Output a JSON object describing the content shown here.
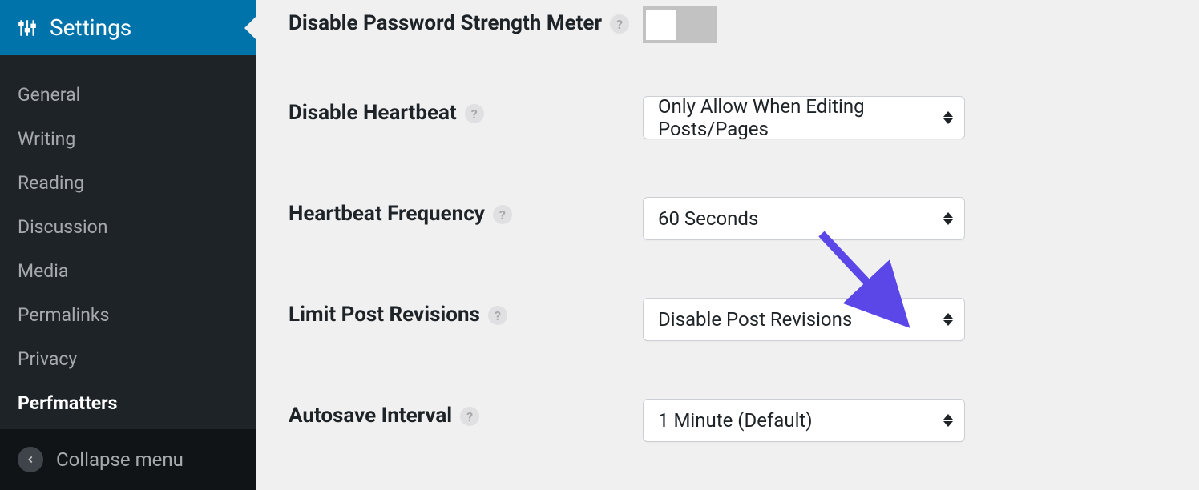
{
  "sidebar": {
    "header": {
      "label": "Settings"
    },
    "items": [
      {
        "label": "General"
      },
      {
        "label": "Writing"
      },
      {
        "label": "Reading"
      },
      {
        "label": "Discussion"
      },
      {
        "label": "Media"
      },
      {
        "label": "Permalinks"
      },
      {
        "label": "Privacy"
      },
      {
        "label": "Perfmatters",
        "active": true
      }
    ],
    "collapse_label": "Collapse menu"
  },
  "settings": {
    "disable_password_meter": {
      "label": "Disable Password Strength Meter",
      "state": "off"
    },
    "disable_heartbeat": {
      "label": "Disable Heartbeat",
      "value": "Only Allow When Editing Posts/Pages"
    },
    "heartbeat_frequency": {
      "label": "Heartbeat Frequency",
      "value": "60 Seconds"
    },
    "limit_post_revisions": {
      "label": "Limit Post Revisions",
      "value": "Disable Post Revisions"
    },
    "autosave_interval": {
      "label": "Autosave Interval",
      "value": "1 Minute (Default)"
    }
  },
  "annotation": {
    "arrow_color": "#5b46e7"
  }
}
